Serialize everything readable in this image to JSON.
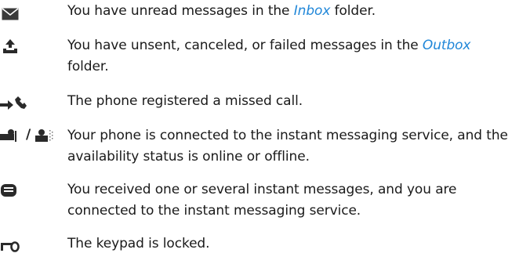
{
  "entries": [
    {
      "icon": "envelope-icon",
      "text_before": "You have unread messages in the ",
      "folder": "Inbox",
      "text_after": " folder."
    },
    {
      "icon": "outbox-tray-icon",
      "text_before": "You have unsent, canceled, or failed messages in the ",
      "folder": "Outbox",
      "text_after": " folder."
    },
    {
      "icon": "missed-call-icon",
      "text": "The phone registered a missed call."
    },
    {
      "icon": "im-online-offline-icon",
      "separator": "/",
      "text": "Your phone is connected to the instant messaging service, and the availability status is online or offline."
    },
    {
      "icon": "instant-message-icon",
      "text": "You received one or several instant messages, and you are connected to the instant messaging service."
    },
    {
      "icon": "keypad-lock-icon",
      "text": "The keypad is locked."
    }
  ]
}
